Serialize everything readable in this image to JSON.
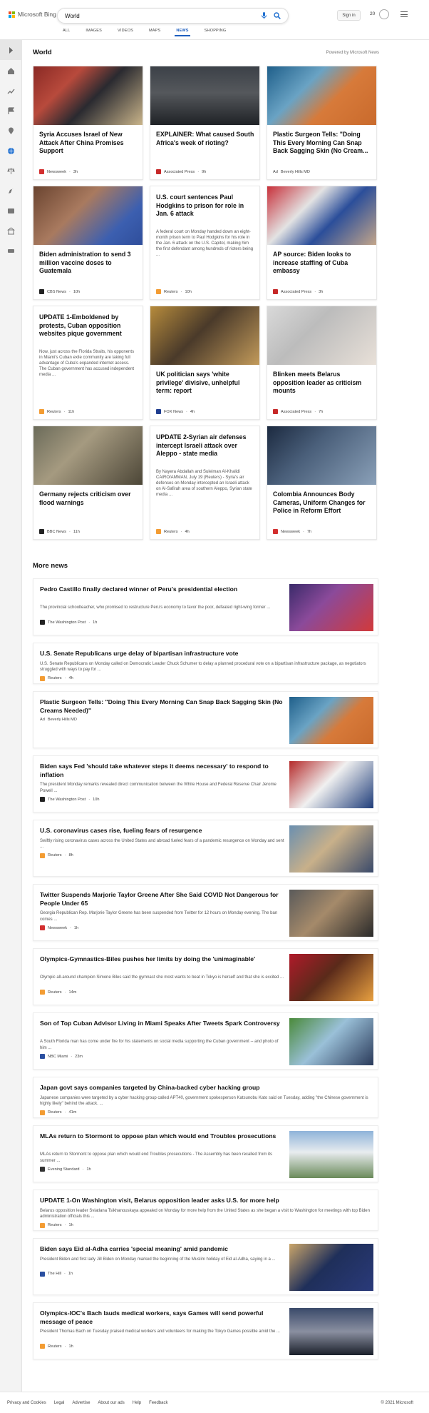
{
  "header": {
    "brand": "Microsoft Bing",
    "query": "World",
    "signin": "Sign in",
    "points": "20",
    "scopes": [
      "ALL",
      "IMAGES",
      "VIDEOS",
      "MAPS",
      "NEWS",
      "SHOPPING"
    ],
    "active_scope": "NEWS"
  },
  "section": {
    "title": "World",
    "powered": "Powered by Microsoft News"
  },
  "cards": [
    {
      "title": "Syria Accuses Israel of New Attack After China Promises Support",
      "snippet": "",
      "source": "Newsweek",
      "age": "3h",
      "src_color": "#d32f2f",
      "image": "officials meeting with flags"
    },
    {
      "title": "EXPLAINER: What caused South Africa's week of rioting?",
      "snippet": "",
      "source": "Associated Press",
      "age": "9h",
      "src_color": "#c62828",
      "image": "police crowd"
    },
    {
      "title": "Plastic Surgeon Tells: \"Doing This Every Morning Can Snap Back Sagging Skin (No Cream...",
      "snippet": "",
      "source": "Beverly Hills MD",
      "age": "",
      "ad": "Ad",
      "src_color": "#ffffff",
      "image": "surgeon close-up"
    },
    {
      "title": "Biden administration to send 3 million vaccine doses to Guatemala",
      "snippet": "",
      "source": "CBS News",
      "age": "10h",
      "src_color": "#222222",
      "image": "vaccine injection"
    },
    {
      "title": "U.S. court sentences Paul Hodgkins to prison for role in Jan. 6 attack",
      "snippet": "A federal court on Monday handed down an eight-month prison term to Paul Hodgkins for his role in the Jan. 6 attack on the U.S. Capitol, making him the first defendant among hundreds of rioters being ...",
      "source": "Reuters",
      "age": "10h",
      "src_color": "#f39c33",
      "image": ""
    },
    {
      "title": "AP source: Biden looks to increase staffing of Cuba embassy",
      "snippet": "",
      "source": "Associated Press",
      "age": "3h",
      "src_color": "#c62828",
      "image": "SOS Cuba protest"
    },
    {
      "title": "UPDATE 1-Emboldened by protests, Cuban opposition websites pique government",
      "snippet": "Now, just across the Florida Straits, his opponents in Miami's Cuban exile community are taking full advantage of Cuba's expanded internet access. The Cuban government has accused independent media ...",
      "source": "Reuters",
      "age": "11h",
      "src_color": "#f39c33",
      "image": ""
    },
    {
      "title": "UK politician says 'white privilege' divisive, unhelpful term: report",
      "snippet": "",
      "source": "FOX News",
      "age": "4h",
      "src_color": "#1f3d8f",
      "image": "politician speaking"
    },
    {
      "title": "Blinken meets Belarus opposition leader as criticism mounts",
      "snippet": "",
      "source": "Associated Press",
      "age": "7h",
      "src_color": "#c62828",
      "image": "opposition leader"
    },
    {
      "title": "Germany rejects criticism over flood warnings",
      "snippet": "",
      "source": "BBC News",
      "age": "11h",
      "src_color": "#222222",
      "image": "flood debris"
    },
    {
      "title": "UPDATE 2-Syrian air defenses intercept Israeli attack over Aleppo - state media",
      "snippet": "By Nayera Abdallah and Suleiman Al-Khalidi CAIRO/AMMAN, July 19 (Reuters) - Syria's air defenses on Monday intercepted an Israeli attack on Al-Safirah area of southern Aleppo, Syrian state media ...",
      "source": "Reuters",
      "age": "4h",
      "src_color": "#f39c33",
      "image": ""
    },
    {
      "title": "Colombia Announces Body Cameras, Uniform Changes for Police in Reform Effort",
      "snippet": "",
      "source": "Newsweek",
      "age": "7h",
      "src_color": "#d32f2f",
      "image": "press conference"
    }
  ],
  "more": {
    "title": "More news",
    "stories": [
      {
        "title": "Pedro Castillo finally declared winner of Peru's presidential election",
        "snippet": "The provincial schoolteacher, who promised to restructure Peru's economy to favor the poor, defeated right-wing former ...",
        "source": "The Washington Post",
        "age": "1h",
        "src_color": "#222222",
        "thumb": true
      },
      {
        "title": "U.S. Senate Republicans urge delay of bipartisan infrastructure vote",
        "snippet": "U.S. Senate Republicans on Monday called on Democratic Leader Chuck Schumer to delay a planned procedural vote on a bipartisan infrastructure package, as negotiators struggled with ways to pay for ...",
        "source": "Reuters",
        "age": "4h",
        "src_color": "#f39c33",
        "thumb": false
      },
      {
        "title": "Plastic Surgeon Tells: \"Doing This Every Morning Can Snap Back Sagging Skin (No Creams Needed)\"",
        "snippet": "",
        "source": "Beverly Hills MD",
        "age": "",
        "ad": "Ad",
        "src_color": "#ffffff",
        "thumb": true
      },
      {
        "title": "Biden says Fed 'should take whatever steps it deems necessary' to respond to inflation",
        "snippet": "The president Monday remarks revealed direct communication between the White House and Federal Reserve Chair Jerome Powell ...",
        "source": "The Washington Post",
        "age": "10h",
        "src_color": "#222222",
        "thumb": true
      },
      {
        "title": "U.S. coronavirus cases rise, fueling fears of resurgence",
        "snippet": "Swiftly rising coronavirus cases across the United States and abroad fueled fears of a pandemic resurgence on Monday and sent ...",
        "source": "Reuters",
        "age": "8h",
        "src_color": "#f39c33",
        "thumb": true
      },
      {
        "title": "Twitter Suspends Marjorie Taylor Greene After She Said COVID Not Dangerous for People Under 65",
        "snippet": "Georgia Republican Rep. Marjorie Taylor Greene has been suspended from Twitter for 12 hours on Monday evening. The ban comes ...",
        "source": "Newsweek",
        "age": "1h",
        "src_color": "#d32f2f",
        "thumb": true
      },
      {
        "title": "Olympics-Gymnastics-Biles pushes her limits by doing the 'unimaginable'",
        "snippet": "Olympic all-around champion Simone Biles said the gymnast she most wants to beat in Tokyo is herself and that she is excited ...",
        "source": "Reuters",
        "age": "14m",
        "src_color": "#f39c33",
        "thumb": true
      },
      {
        "title": "Son of Top Cuban Advisor Living in Miami Speaks After Tweets Spark Controversy",
        "snippet": "A South Florida man has come under fire for his statements on social media supporting the Cuban government -- and photo of him ...",
        "source": "NBC Miami",
        "age": "23m",
        "src_color": "#2a4fa0",
        "thumb": true
      },
      {
        "title": "Japan govt says companies targeted by China-backed cyber hacking group",
        "snippet": "Japanese companies were targeted by a cyber hacking group called APT40, government spokesperson Katsunobu Kato said on Tuesday, adding \"the Chinese government is highly likely\" behind the attack. ...",
        "source": "Reuters",
        "age": "41m",
        "src_color": "#f39c33",
        "thumb": false
      },
      {
        "title": "MLAs return to Stormont to oppose plan which would end Troubles prosecutions",
        "snippet": "MLAs return to Stormont to oppose plan which would end Troubles prosecutions - The Assembly has been recalled from its summer ...",
        "source": "Evening Standard",
        "age": "1h",
        "src_color": "#333333",
        "thumb": true
      },
      {
        "title": "UPDATE 1-On Washington visit, Belarus opposition leader asks U.S. for more help",
        "snippet": "Belarus opposition leader Sviatlana Tsikhanouskaya appealed on Monday for more help from the United States as she began a visit to Washington for meetings with top Biden administration officials this ...",
        "source": "Reuters",
        "age": "1h",
        "src_color": "#f39c33",
        "thumb": false
      },
      {
        "title": "Biden says Eid al-Adha carries 'special meaning' amid pandemic",
        "snippet": "President Biden and first lady Jill Biden on Monday marked the beginning of the Muslim holiday of Eid al-Adha, saying in a ...",
        "source": "The Hill",
        "age": "1h",
        "src_color": "#2a4fa0",
        "thumb": true
      },
      {
        "title": "Olympics-IOC's Bach lauds medical workers, says Games will send powerful message of peace",
        "snippet": "President Thomas Bach on Tuesday praised medical workers and volunteers for making the Tokyo Games possible amid the ...",
        "source": "Reuters",
        "age": "1h",
        "src_color": "#f39c33",
        "thumb": true
      }
    ]
  },
  "footer": {
    "links": [
      "Privacy and Cookies",
      "Legal",
      "Advertise",
      "About our ads",
      "Help",
      "Feedback"
    ],
    "copyright": "© 2021 Microsoft"
  }
}
